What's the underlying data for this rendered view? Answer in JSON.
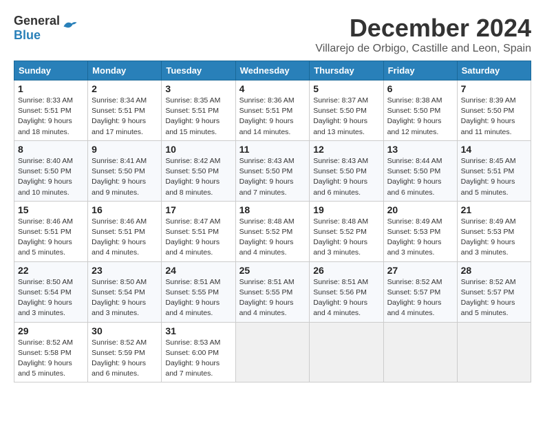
{
  "logo": {
    "general": "General",
    "blue": "Blue"
  },
  "title": "December 2024",
  "location": "Villarejo de Orbigo, Castille and Leon, Spain",
  "weekdays": [
    "Sunday",
    "Monday",
    "Tuesday",
    "Wednesday",
    "Thursday",
    "Friday",
    "Saturday"
  ],
  "weeks": [
    [
      {
        "day": "1",
        "info": "Sunrise: 8:33 AM\nSunset: 5:51 PM\nDaylight: 9 hours and 18 minutes."
      },
      {
        "day": "2",
        "info": "Sunrise: 8:34 AM\nSunset: 5:51 PM\nDaylight: 9 hours and 17 minutes."
      },
      {
        "day": "3",
        "info": "Sunrise: 8:35 AM\nSunset: 5:51 PM\nDaylight: 9 hours and 15 minutes."
      },
      {
        "day": "4",
        "info": "Sunrise: 8:36 AM\nSunset: 5:51 PM\nDaylight: 9 hours and 14 minutes."
      },
      {
        "day": "5",
        "info": "Sunrise: 8:37 AM\nSunset: 5:50 PM\nDaylight: 9 hours and 13 minutes."
      },
      {
        "day": "6",
        "info": "Sunrise: 8:38 AM\nSunset: 5:50 PM\nDaylight: 9 hours and 12 minutes."
      },
      {
        "day": "7",
        "info": "Sunrise: 8:39 AM\nSunset: 5:50 PM\nDaylight: 9 hours and 11 minutes."
      }
    ],
    [
      {
        "day": "8",
        "info": "Sunrise: 8:40 AM\nSunset: 5:50 PM\nDaylight: 9 hours and 10 minutes."
      },
      {
        "day": "9",
        "info": "Sunrise: 8:41 AM\nSunset: 5:50 PM\nDaylight: 9 hours and 9 minutes."
      },
      {
        "day": "10",
        "info": "Sunrise: 8:42 AM\nSunset: 5:50 PM\nDaylight: 9 hours and 8 minutes."
      },
      {
        "day": "11",
        "info": "Sunrise: 8:43 AM\nSunset: 5:50 PM\nDaylight: 9 hours and 7 minutes."
      },
      {
        "day": "12",
        "info": "Sunrise: 8:43 AM\nSunset: 5:50 PM\nDaylight: 9 hours and 6 minutes."
      },
      {
        "day": "13",
        "info": "Sunrise: 8:44 AM\nSunset: 5:50 PM\nDaylight: 9 hours and 6 minutes."
      },
      {
        "day": "14",
        "info": "Sunrise: 8:45 AM\nSunset: 5:51 PM\nDaylight: 9 hours and 5 minutes."
      }
    ],
    [
      {
        "day": "15",
        "info": "Sunrise: 8:46 AM\nSunset: 5:51 PM\nDaylight: 9 hours and 5 minutes."
      },
      {
        "day": "16",
        "info": "Sunrise: 8:46 AM\nSunset: 5:51 PM\nDaylight: 9 hours and 4 minutes."
      },
      {
        "day": "17",
        "info": "Sunrise: 8:47 AM\nSunset: 5:51 PM\nDaylight: 9 hours and 4 minutes."
      },
      {
        "day": "18",
        "info": "Sunrise: 8:48 AM\nSunset: 5:52 PM\nDaylight: 9 hours and 4 minutes."
      },
      {
        "day": "19",
        "info": "Sunrise: 8:48 AM\nSunset: 5:52 PM\nDaylight: 9 hours and 3 minutes."
      },
      {
        "day": "20",
        "info": "Sunrise: 8:49 AM\nSunset: 5:53 PM\nDaylight: 9 hours and 3 minutes."
      },
      {
        "day": "21",
        "info": "Sunrise: 8:49 AM\nSunset: 5:53 PM\nDaylight: 9 hours and 3 minutes."
      }
    ],
    [
      {
        "day": "22",
        "info": "Sunrise: 8:50 AM\nSunset: 5:54 PM\nDaylight: 9 hours and 3 minutes."
      },
      {
        "day": "23",
        "info": "Sunrise: 8:50 AM\nSunset: 5:54 PM\nDaylight: 9 hours and 3 minutes."
      },
      {
        "day": "24",
        "info": "Sunrise: 8:51 AM\nSunset: 5:55 PM\nDaylight: 9 hours and 4 minutes."
      },
      {
        "day": "25",
        "info": "Sunrise: 8:51 AM\nSunset: 5:55 PM\nDaylight: 9 hours and 4 minutes."
      },
      {
        "day": "26",
        "info": "Sunrise: 8:51 AM\nSunset: 5:56 PM\nDaylight: 9 hours and 4 minutes."
      },
      {
        "day": "27",
        "info": "Sunrise: 8:52 AM\nSunset: 5:57 PM\nDaylight: 9 hours and 4 minutes."
      },
      {
        "day": "28",
        "info": "Sunrise: 8:52 AM\nSunset: 5:57 PM\nDaylight: 9 hours and 5 minutes."
      }
    ],
    [
      {
        "day": "29",
        "info": "Sunrise: 8:52 AM\nSunset: 5:58 PM\nDaylight: 9 hours and 5 minutes."
      },
      {
        "day": "30",
        "info": "Sunrise: 8:52 AM\nSunset: 5:59 PM\nDaylight: 9 hours and 6 minutes."
      },
      {
        "day": "31",
        "info": "Sunrise: 8:53 AM\nSunset: 6:00 PM\nDaylight: 9 hours and 7 minutes."
      },
      null,
      null,
      null,
      null
    ]
  ]
}
